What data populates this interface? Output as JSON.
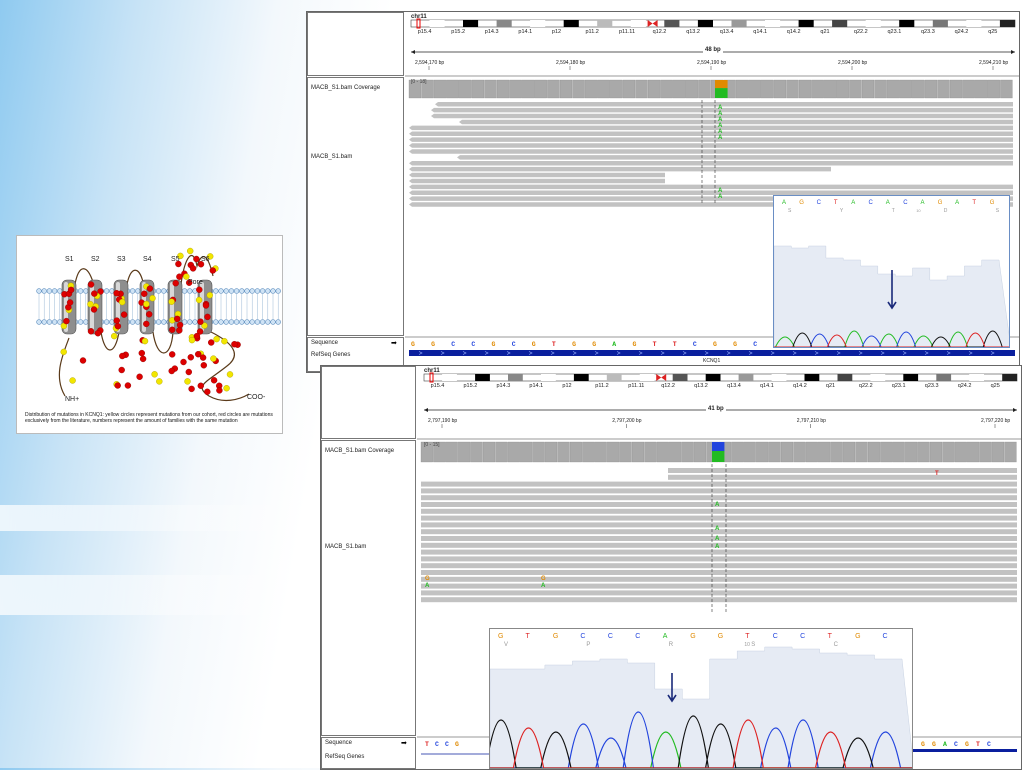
{
  "figure": {
    "caption": "Distribution of mutations in KCNQ1: yellow circles represent mutations from our cohort, red circles are mutations exclusively from the literature, numbers represent the amount of families with the same mutation",
    "segments": [
      "S1",
      "S2",
      "S3",
      "S4",
      "S5",
      "S6"
    ],
    "pore_label": "Pore",
    "n_term": "NH+",
    "c_term": "COO-"
  },
  "igv_top": {
    "chrom": "chr11",
    "bands": [
      "p15.4",
      "p15.2",
      "p14.3",
      "p14.1",
      "p12",
      "p11.2",
      "p11.11",
      "q12.2",
      "q13.2",
      "q13.4",
      "q14.1",
      "q14.2",
      "q21",
      "q22.2",
      "q23.1",
      "q23.3",
      "q24.2",
      "q25"
    ],
    "span": "48 bp",
    "ticks": [
      "2,594,170 bp",
      "2,594,180 bp",
      "2,594,190 bp",
      "2,594,200 bp",
      "2,594,210 bp"
    ],
    "coverage_label": "MACB_S1.bam Coverage",
    "coverage_range": "[0 - 18]",
    "bam_label": "MACB_S1.bam",
    "sequence_label": "Sequence",
    "refseq_label": "RefSeq Genes",
    "gene": "KCNQ1",
    "sequence": "GGCCGCGTGGAGTTCGGCAGCTACGCAGAG",
    "variant_base": "A",
    "chromatogram_bases": "AGCTACACAGATG",
    "chromatogram_aa": [
      "S",
      "Y",
      "T",
      "D",
      "S"
    ],
    "chromatogram_pos": "10"
  },
  "igv_bottom": {
    "chrom": "chr11",
    "bands": [
      "p15.4",
      "p15.2",
      "p14.3",
      "p14.1",
      "p12",
      "p11.2",
      "p11.11",
      "q12.2",
      "q13.2",
      "q13.4",
      "q14.1",
      "q14.2",
      "q21",
      "q22.2",
      "q23.1",
      "q23.3",
      "q24.2",
      "q25"
    ],
    "span": "41 bp",
    "ticks": [
      "2,797,190 bp",
      "2,797,200 bp",
      "2,797,210 bp",
      "2,797,220 bp"
    ],
    "coverage_label": "MACB_S1.bam Coverage",
    "coverage_range": "[0 - 15]",
    "bam_label": "MACB_S1.bam",
    "sequence_label": "Sequence",
    "refseq_label": "RefSeq Genes",
    "seq_left": "TCCG",
    "seq_right": "GGACGTC",
    "variant_base": "A",
    "other_bases": [
      "G",
      "A",
      "G",
      "A",
      "T"
    ],
    "chromatogram_bases": "GTGCCCAGGTCCTGC",
    "chromatogram_aa": [
      "V",
      "P",
      "R",
      "S",
      "C"
    ],
    "chromatogram_pos": "10"
  },
  "colors": {
    "A": "#22bb22",
    "C": "#2244dd",
    "G": "#e08a00",
    "T": "#dd2222",
    "mutation_red": "#dd0000",
    "mutation_yellow": "#f2e600",
    "refseq_blue": "#0a1f9e",
    "coverage_gray": "#a9a9a9",
    "read_gray": "#c2c2c2"
  }
}
